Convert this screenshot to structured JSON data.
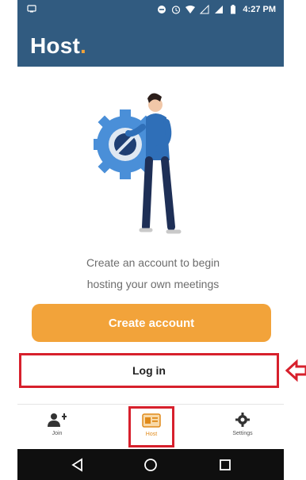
{
  "status_bar": {
    "time": "4:27 PM"
  },
  "header": {
    "title": "Host",
    "title_dot": "."
  },
  "prompt": {
    "line1": "Create an account to begin",
    "line2": "hosting your own meetings"
  },
  "buttons": {
    "create": "Create account",
    "login": "Log in"
  },
  "nav": {
    "join": "Join",
    "host": "Host",
    "settings": "Settings"
  },
  "colors": {
    "header": "#315b80",
    "accent": "#f2a33a",
    "highlight": "#d7202c"
  }
}
